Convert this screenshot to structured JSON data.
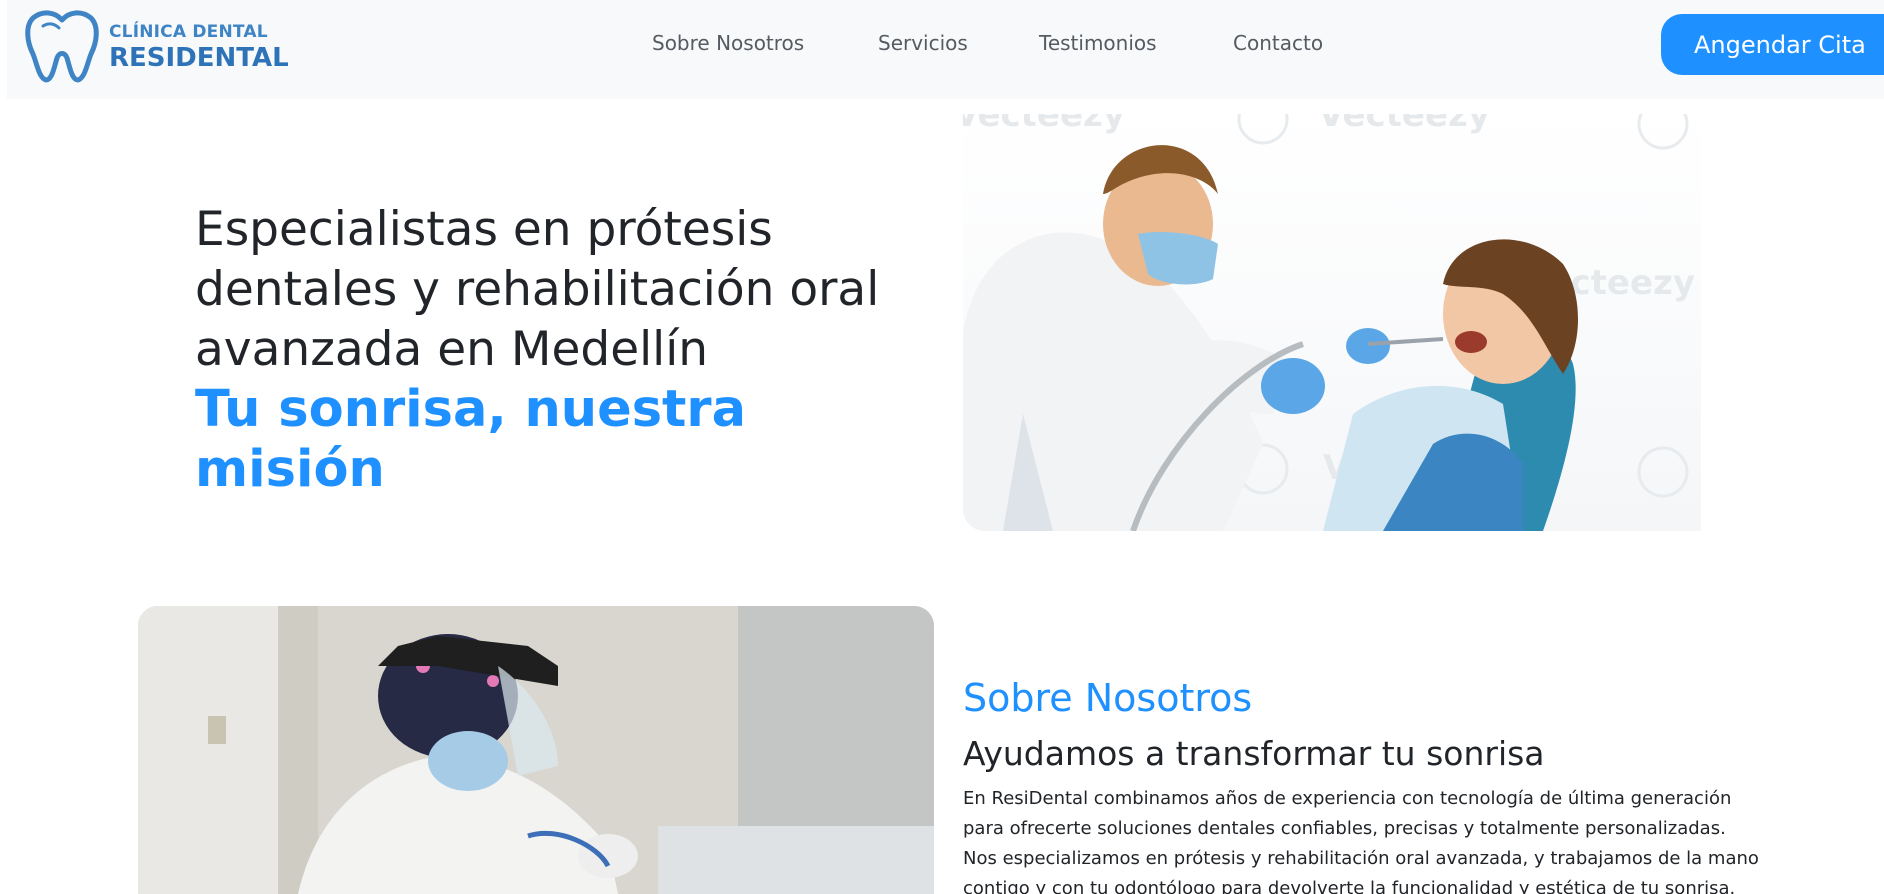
{
  "navbar": {
    "logo": {
      "line1": "CLÍNICA DENTAL",
      "line2": "RESIDENTAL",
      "icon": "tooth-icon"
    },
    "links": [
      {
        "label": "Sobre Nosotros"
      },
      {
        "label": "Servicios"
      },
      {
        "label": "Testimonios"
      },
      {
        "label": "Contacto"
      }
    ],
    "cta_label": "Angendar Cita"
  },
  "hero": {
    "title": "Especialistas en prótesis dentales y rehabilitación oral avanzada en Medellín",
    "subtitle": "Tu sonrisa, nuestra misión",
    "watermark": "Vecteezy"
  },
  "about": {
    "label": "Sobre Nosotros",
    "title": "Ayudamos a transformar tu sonrisa",
    "body": "En ResiDental combinamos años de experiencia con tecnología de última generación para ofrecerte soluciones dentales confiables, precisas y totalmente personalizadas. Nos especializamos en prótesis y rehabilitación oral avanzada, y trabajamos de la mano contigo y con tu odontólogo para devolverte la funcionalidad y estética de tu sonrisa."
  },
  "colors": {
    "accent": "#1e90ff",
    "brand": "#2e73b8",
    "navbar_bg": "#f8f9fa",
    "text": "#212529"
  }
}
